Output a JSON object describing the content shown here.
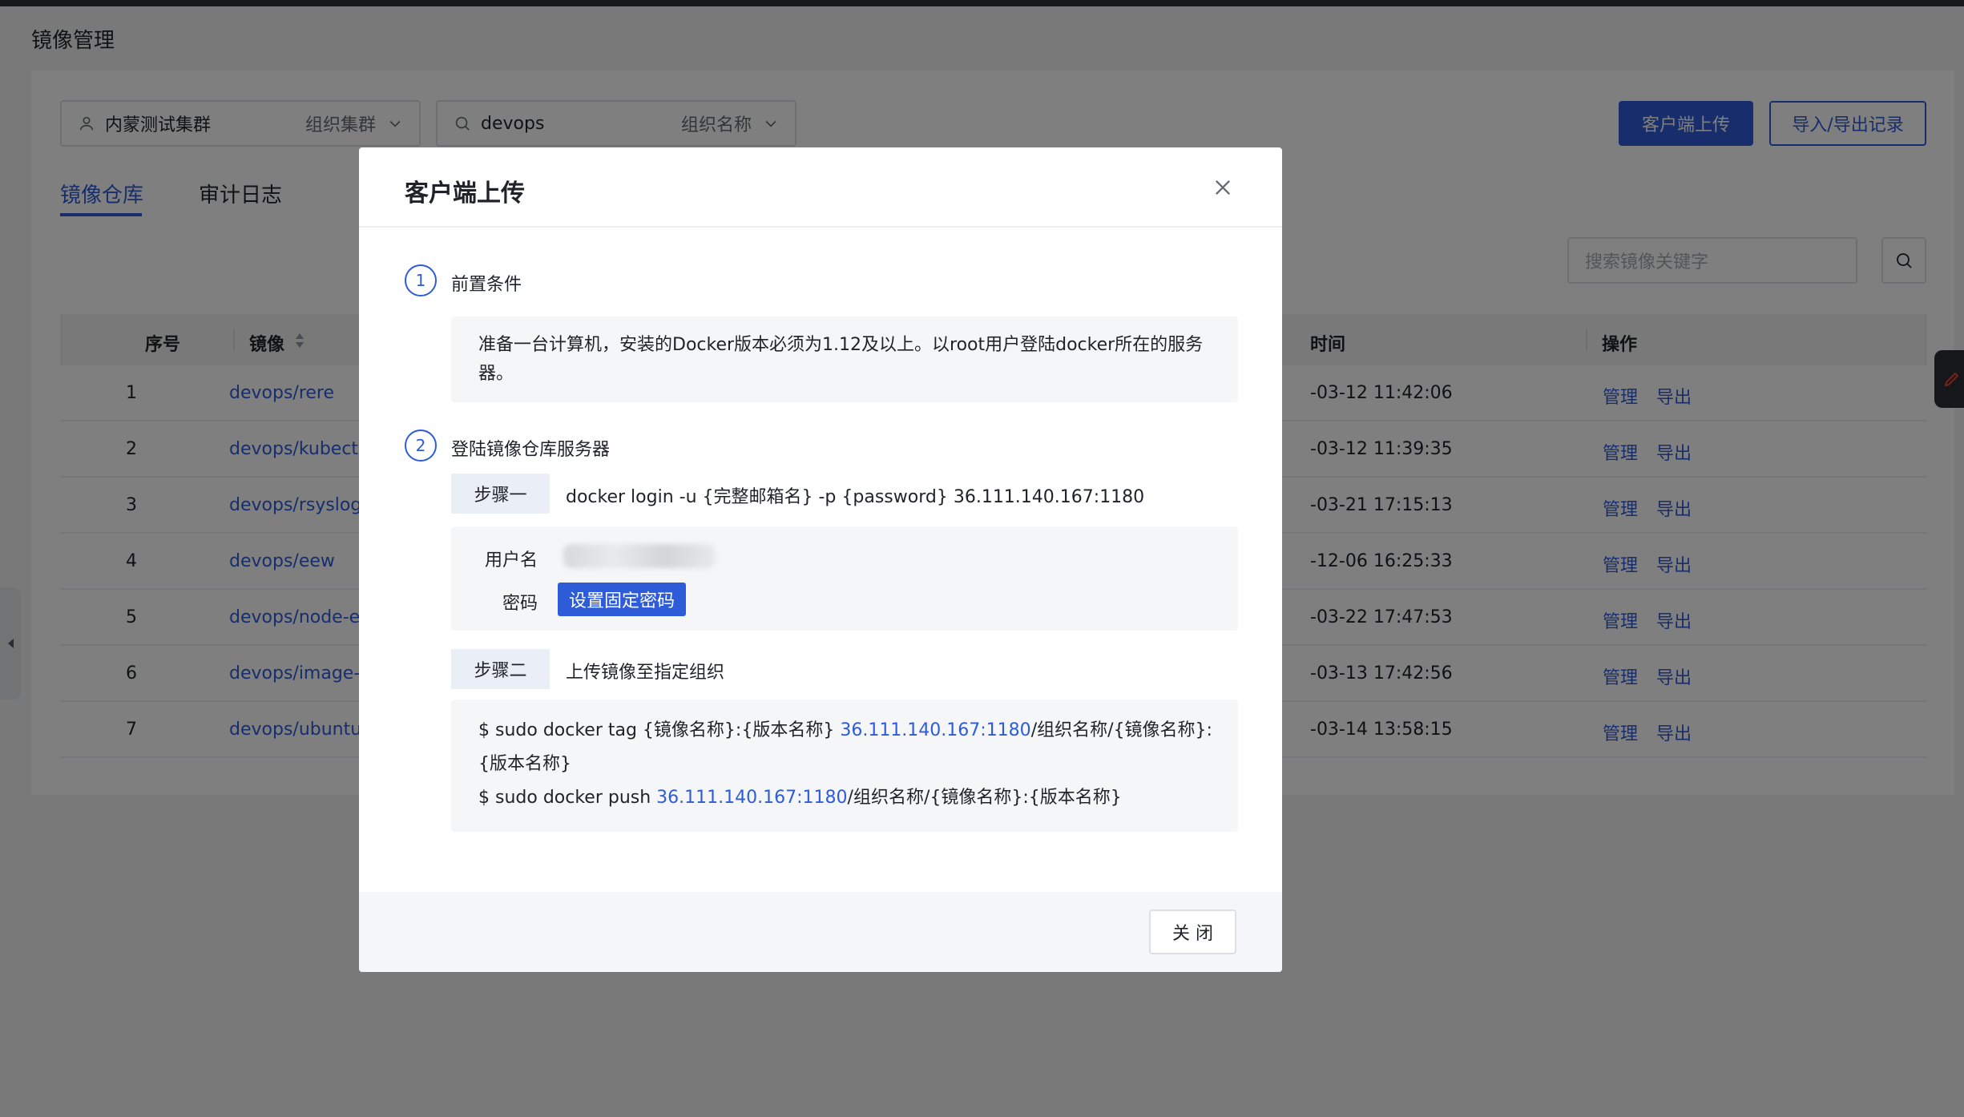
{
  "page": {
    "title": "镜像管理"
  },
  "filters": {
    "cluster": {
      "value": "内蒙测试集群",
      "label": "组织集群"
    },
    "org": {
      "value": "devops",
      "label": "组织名称"
    }
  },
  "toolbar": {
    "upload_label": "客户端上传",
    "records_label": "导入/导出记录"
  },
  "tabs": [
    {
      "label": "镜像仓库"
    },
    {
      "label": "审计日志"
    }
  ],
  "search": {
    "placeholder": "搜索镜像关键字"
  },
  "table": {
    "headers": {
      "no": "序号",
      "image": "镜像",
      "time": "时间",
      "action": "操作"
    },
    "rows": [
      {
        "no": "1",
        "image": "devops/rere",
        "time": "-03-12 11:42:06"
      },
      {
        "no": "2",
        "image": "devops/kubectl-da",
        "time": "-03-12 11:39:35"
      },
      {
        "no": "3",
        "image": "devops/rsyslog",
        "time": "-03-21 17:15:13"
      },
      {
        "no": "4",
        "image": "devops/eew",
        "time": "-12-06 16:25:33"
      },
      {
        "no": "5",
        "image": "devops/node-expo",
        "time": "-03-22 17:47:53"
      },
      {
        "no": "6",
        "image": "devops/image-ma",
        "time": "-03-13 17:42:56"
      },
      {
        "no": "7",
        "image": "devops/ubuntu",
        "time": "-03-14 13:58:15"
      }
    ],
    "actions": {
      "manage": "管理",
      "export": "导出"
    }
  },
  "modal": {
    "title": "客户端上传",
    "step1": {
      "num": "1",
      "title": "前置条件",
      "text": "准备一台计算机，安装的Docker版本必须为1.12及以上。以root用户登陆docker所在的服务器。"
    },
    "step2": {
      "num": "2",
      "title": "登陆镜像仓库服务器",
      "sub1": {
        "tag": "步骤一",
        "cmd": "docker login -u {完整邮箱名} -p {password} 36.111.140.167:1180"
      },
      "cred": {
        "user_label": "用户名",
        "pwd_label": "密码",
        "pwd_button": "设置固定密码"
      },
      "sub2": {
        "tag": "步骤二",
        "text": "上传镜像至指定组织"
      },
      "cmd_tag": {
        "prefix": "$ sudo docker tag {镜像名称}:{版本名称} ",
        "host": "36.111.140.167:1180",
        "suffix": "/组织名称/{镜像名称}:{版本名称}"
      },
      "cmd_push": {
        "prefix": "$ sudo docker push ",
        "host": "36.111.140.167:1180",
        "suffix": "/组织名称/{镜像名称}:{版本名称}"
      }
    },
    "footer": {
      "close_label": "关 闭"
    }
  },
  "colors": {
    "primary": "#2e5bd8",
    "mask": "rgba(0,0,0,0.5)"
  }
}
